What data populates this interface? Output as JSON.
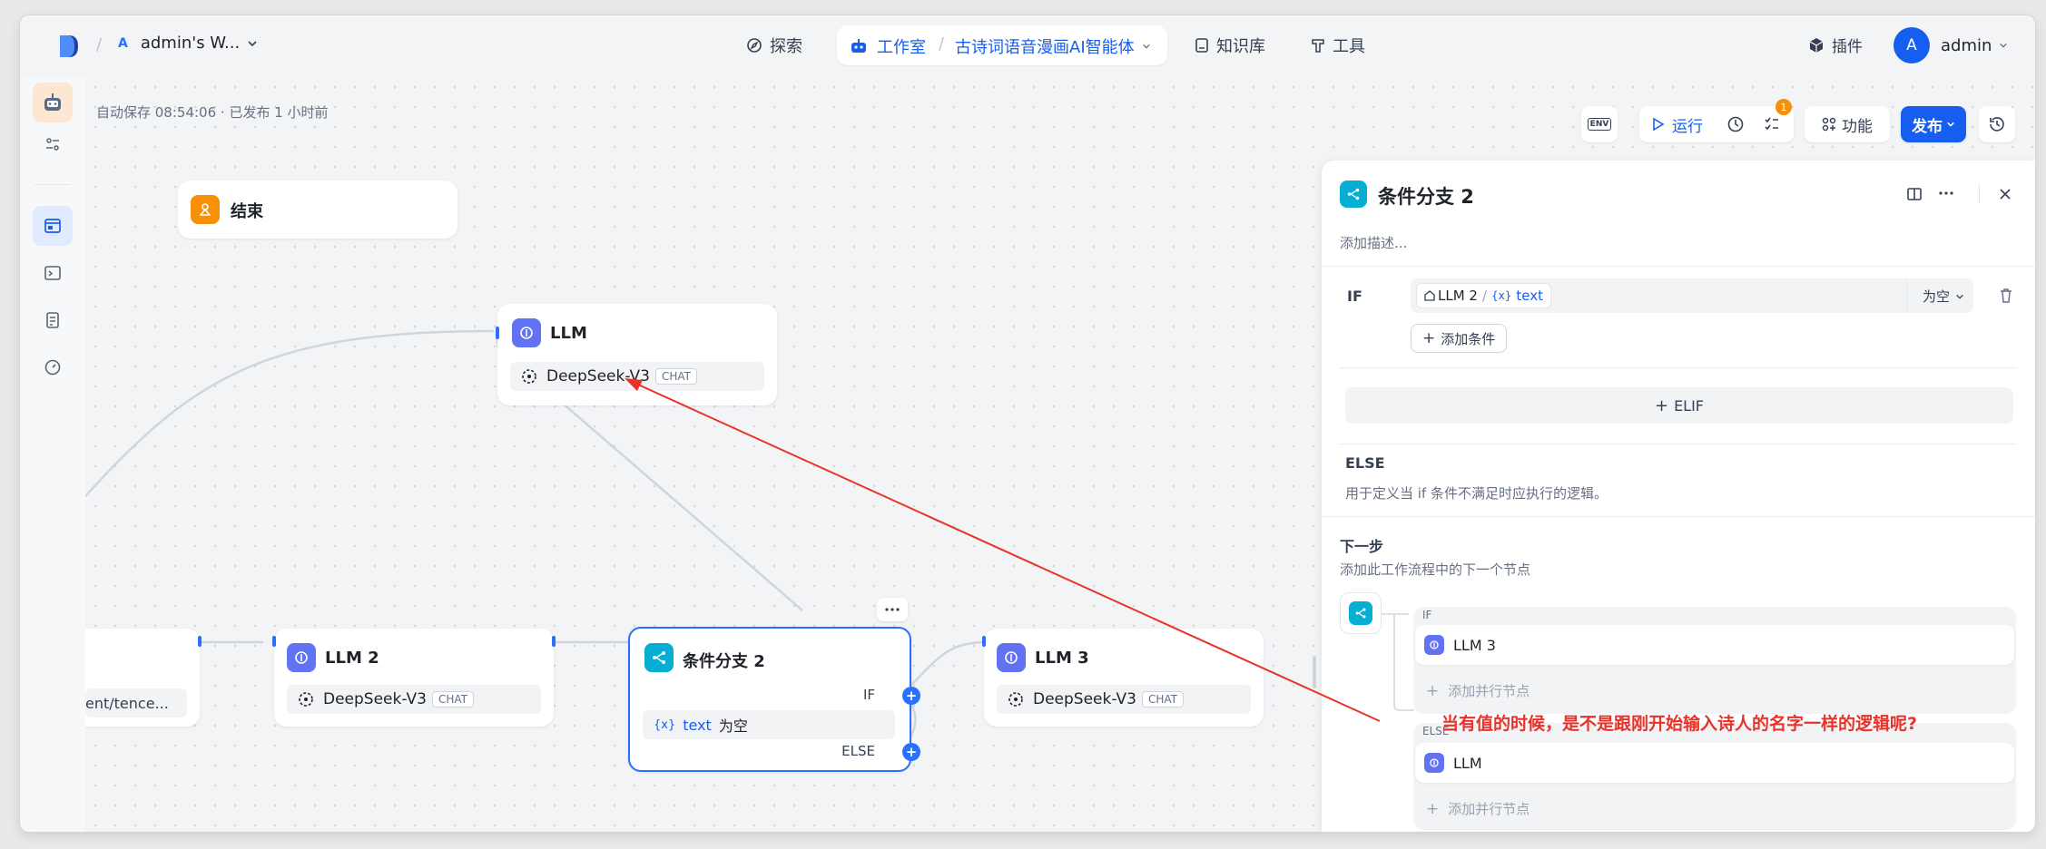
{
  "topbar": {
    "workspace_initial": "A",
    "workspace_name": "admin's W...",
    "explore": "探索",
    "studio": "工作室",
    "app_name": "古诗词语音漫画AI智能体",
    "knowledge": "知识库",
    "tools": "工具",
    "plugins": "插件",
    "user_initial": "A",
    "user_name": "admin"
  },
  "canvas": {
    "autosave": "自动保存 08:54:06 · 已发布 1 小时前"
  },
  "toolbar": {
    "env": "ENV",
    "run": "运行",
    "badge": "1",
    "features": "功能",
    "publish": "发布"
  },
  "nodes": {
    "end": {
      "title": "结束"
    },
    "llm": {
      "title": "LLM",
      "model": "DeepSeek-V3",
      "tag": "CHAT"
    },
    "left_partial": {
      "text": "ent/tence..."
    },
    "llm2": {
      "title": "LLM 2",
      "model": "DeepSeek-V3",
      "tag": "CHAT"
    },
    "ifelse": {
      "title": "条件分支 2",
      "if_label": "IF",
      "else_label": "ELSE",
      "cond_var": "text",
      "cond_op": "为空",
      "var_prefix": "{x}"
    },
    "llm3": {
      "title": "LLM 3",
      "model": "DeepSeek-V3",
      "tag": "CHAT"
    }
  },
  "annotation": {
    "text": "当有值的时候，是不是跟刚开始输入诗人的名字一样的逻辑呢?",
    "color": "#e8332a"
  },
  "panel": {
    "title": "条件分支 2",
    "desc_placeholder": "添加描述...",
    "if_label": "IF",
    "cond_node": "LLM 2",
    "cond_sep": "/",
    "cond_var_prefix": "{x}",
    "cond_var": "text",
    "cond_op": "为空",
    "add_condition": "添加条件",
    "elif": "ELIF",
    "else_label": "ELSE",
    "else_desc": "用于定义当 if 条件不满足时应执行的逻辑。",
    "next_title": "下一步",
    "next_desc": "添加此工作流程中的下一个节点",
    "branch_if": "IF",
    "branch_if_node": "LLM 3",
    "add_parallel_1": "添加并行节点",
    "branch_else": "ELSE",
    "branch_else_node": "LLM",
    "add_parallel_2": "添加并行节点"
  },
  "colors": {
    "accent": "#2970ff",
    "llm_icon": "#6172f3",
    "ifelse_icon": "#06aed4",
    "end_icon": "#f79009"
  }
}
